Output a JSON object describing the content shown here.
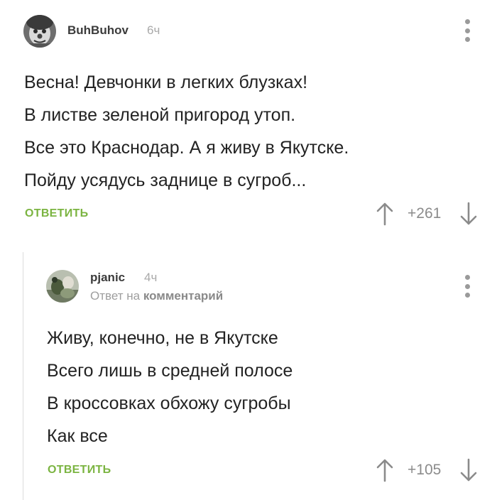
{
  "comments": [
    {
      "author": "BuhBuhov",
      "time": "6ч",
      "lines": [
        "Весна! Девчонки в легких блузках!",
        "В листве зеленой пригород утоп.",
        "Все это Краснодар. А я живу в Якутске.",
        "Пойду усядусь заднице в сугроб..."
      ],
      "reply_label": "ОТВЕТИТЬ",
      "score": "+261"
    },
    {
      "author": "pjanic",
      "time": "4ч",
      "reply_prefix": "Ответ на",
      "reply_target": "комментарий",
      "lines": [
        "Живу, конечно, не в Якутске",
        "Всего лишь в средней полосе",
        "В кроссовках обхожу сугробы",
        "Как все"
      ],
      "reply_label": "ОТВЕТИТЬ",
      "score": "+105"
    }
  ],
  "colors": {
    "accent": "#7bb441",
    "muted": "#9a9a9a",
    "text": "#232323"
  },
  "icons": [
    "more-vertical-icon",
    "arrow-up-icon",
    "arrow-down-icon"
  ]
}
